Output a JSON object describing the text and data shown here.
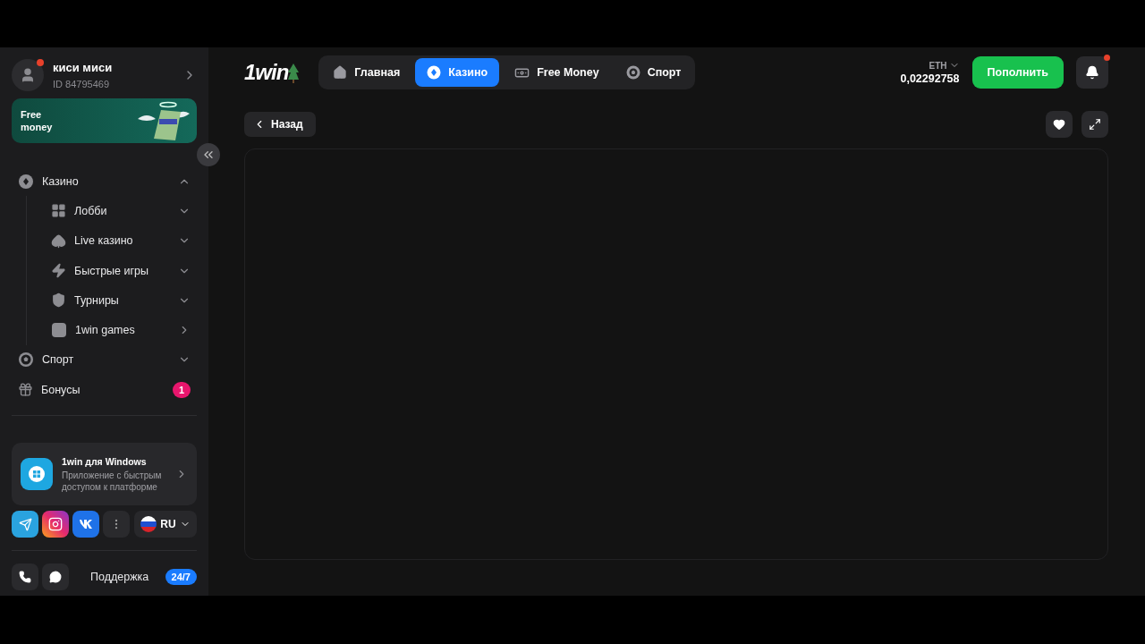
{
  "profile": {
    "name": "киси миси",
    "id": "ID 84795469",
    "notification": true
  },
  "promo": {
    "title": "Free money"
  },
  "menu": [
    {
      "label": "Казино",
      "kind": "group",
      "expanded": true,
      "children": [
        {
          "label": "Лобби",
          "kind": "group",
          "expanded": false
        },
        {
          "label": "Live казино",
          "kind": "group",
          "expanded": false
        },
        {
          "label": "Быстрые игры",
          "kind": "group",
          "expanded": false
        },
        {
          "label": "Турниры",
          "kind": "group",
          "expanded": false
        },
        {
          "label": "1win games",
          "kind": "link"
        }
      ]
    },
    {
      "label": "Спорт",
      "kind": "group",
      "expanded": false
    },
    {
      "label": "Бонусы",
      "kind": "badge",
      "badge": "1"
    }
  ],
  "app_card": {
    "title": "1win для Windows",
    "text": "Приложение с быстрым доступом к платформе"
  },
  "language": {
    "code": "RU"
  },
  "support": {
    "label": "Поддержка",
    "badge": "24/7"
  },
  "logo": {
    "text": "1win"
  },
  "tabs": [
    {
      "label": "Главная",
      "selected": false
    },
    {
      "label": "Казино",
      "selected": true
    },
    {
      "label": "Free Money",
      "selected": false
    },
    {
      "label": "Спорт",
      "selected": false
    }
  ],
  "balance": {
    "currency": "ETH",
    "amount": "0,02292758"
  },
  "deposit_button": "Пополнить",
  "notifications": {
    "unread": true
  },
  "back_button": "Назад"
}
